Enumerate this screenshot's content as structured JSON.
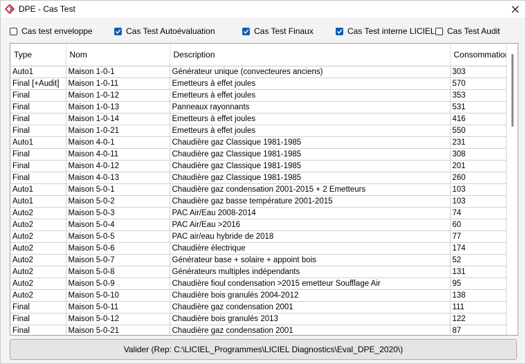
{
  "window": {
    "title": "DPE - Cas Test",
    "close_icon": "close-icon"
  },
  "filters": [
    {
      "label": "Cas test enveloppe",
      "checked": false
    },
    {
      "label": "Cas Test Autoévaluation",
      "checked": true
    },
    {
      "label": "Cas Test Finaux",
      "checked": true
    },
    {
      "label": "Cas Test interne LICIEL",
      "checked": true
    },
    {
      "label": "Cas Test Audit",
      "checked": false
    }
  ],
  "table": {
    "columns": [
      "Type",
      "Nom",
      "Description",
      "Consommation"
    ],
    "rows": [
      [
        "Auto1",
        "Maison 1-0-1",
        "Générateur unique (convecteures anciens)",
        "303"
      ],
      [
        "Final [+Audit]",
        "Maison 1-0-11",
        "Emetteurs à effet joules",
        "570"
      ],
      [
        "Final",
        "Maison 1-0-12",
        "Emetteurs à effet joules",
        "353"
      ],
      [
        "Final",
        "Maison 1-0-13",
        "Panneaux rayonnants",
        "531"
      ],
      [
        "Final",
        "Maison 1-0-14",
        "Emetteurs à effet joules",
        "416"
      ],
      [
        "Final",
        "Maison 1-0-21",
        "Emetteurs à effet joules",
        "550"
      ],
      [
        "Auto1",
        "Maison 4-0-1",
        "Chaudière gaz Classique 1981-1985",
        "231"
      ],
      [
        "Final",
        "Maison 4-0-11",
        "Chaudière gaz Classique 1981-1985",
        "308"
      ],
      [
        "Final",
        "Maison 4-0-12",
        "Chaudière gaz Classique 1981-1985",
        "201"
      ],
      [
        "Final",
        "Maison 4-0-13",
        "Chaudière gaz Classique 1981-1985",
        "260"
      ],
      [
        "Auto1",
        "Maison 5-0-1",
        "Chaudière gaz condensation 2001-2015 + 2 Emetteurs",
        "103"
      ],
      [
        "Auto1",
        "Maison 5-0-2",
        "Chaudière gaz basse température 2001-2015",
        "103"
      ],
      [
        "Auto2",
        "Maison 5-0-3",
        "PAC Air/Eau 2008-2014",
        "74"
      ],
      [
        "Auto2",
        "Maison 5-0-4",
        "PAC Air/Eau >2016",
        "60"
      ],
      [
        "Auto2",
        "Maison 5-0-5",
        "PAC air/eau hybride de 2018",
        "77"
      ],
      [
        "Auto2",
        "Maison 5-0-6",
        "Chaudière électrique",
        "174"
      ],
      [
        "Auto2",
        "Maison 5-0-7",
        "Générateur base + solaire + appoint bois",
        "52"
      ],
      [
        "Auto2",
        "Maison 5-0-8",
        "Générateurs multiples indépendants",
        "131"
      ],
      [
        "Auto2",
        "Maison 5-0-9",
        "Chaudière fioul condensation >2015 emetteur Soufflage Air",
        "95"
      ],
      [
        "Auto2",
        "Maison 5-0-10",
        "Chaudière bois granulés 2004-2012",
        "138"
      ],
      [
        "Final",
        "Maison 5-0-11",
        "Chaudière gaz condensation 2001",
        "111"
      ],
      [
        "Final",
        "Maison 5-0-12",
        "Chaudière bois granulés 2013",
        "122"
      ],
      [
        "Final",
        "Maison 5-0-21",
        "Chaudière gaz condensation 2001",
        "87"
      ]
    ]
  },
  "validate_button": {
    "label": "Valider (Rep: C:\\LICIEL_Programmes\\LICIEL Diagnostics\\Eval_DPE_2020\\)"
  },
  "colors": {
    "accent": "#0a5fb4",
    "app_icon": "#d93a3a"
  }
}
